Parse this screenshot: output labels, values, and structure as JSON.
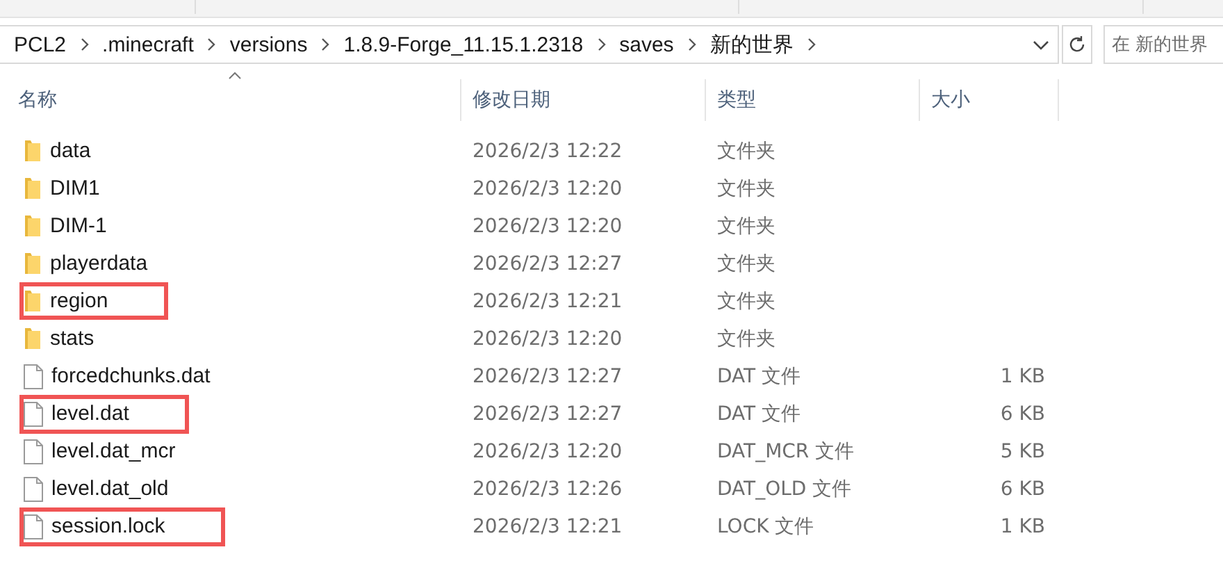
{
  "address_bar": {
    "crumbs": [
      "PCL2",
      ".minecraft",
      "versions",
      "1.8.9-Forge_11.15.1.2318",
      "saves",
      "新的世界"
    ]
  },
  "search": {
    "placeholder": "在 新的世界"
  },
  "table": {
    "columns": [
      {
        "label": "名称",
        "sorted": true
      },
      {
        "label": "修改日期",
        "sorted": false
      },
      {
        "label": "类型",
        "sorted": false
      },
      {
        "label": "大小",
        "sorted": false
      }
    ],
    "rows": [
      {
        "kind": "folder",
        "name": "data",
        "date": "2026/2/3 12:22",
        "type": "文件夹",
        "highlighted": false
      },
      {
        "kind": "folder",
        "name": "DIM1",
        "date": "2026/2/3 12:20",
        "type": "文件夹",
        "highlighted": false
      },
      {
        "kind": "folder",
        "name": "DIM-1",
        "date": "2026/2/3 12:20",
        "type": "文件夹",
        "highlighted": false
      },
      {
        "kind": "folder",
        "name": "playerdata",
        "date": "2026/2/3 12:27",
        "type": "文件夹",
        "highlighted": false
      },
      {
        "kind": "folder",
        "name": "region",
        "date": "2026/2/3 12:21",
        "type": "文件夹",
        "highlighted": true
      },
      {
        "kind": "folder",
        "name": "stats",
        "date": "2026/2/3 12:20",
        "type": "文件夹",
        "highlighted": false
      },
      {
        "kind": "file",
        "name": "forcedchunks.dat",
        "date": "2026/2/3 12:27",
        "type": "DAT 文件",
        "size": "1 KB",
        "highlighted": false
      },
      {
        "kind": "file",
        "name": "level.dat",
        "date": "2026/2/3 12:27",
        "type": "DAT 文件",
        "size": "6 KB",
        "highlighted": true
      },
      {
        "kind": "file",
        "name": "level.dat_mcr",
        "date": "2026/2/3 12:20",
        "type": "DAT_MCR 文件",
        "size": "5 KB",
        "highlighted": false
      },
      {
        "kind": "file",
        "name": "level.dat_old",
        "date": "2026/2/3 12:26",
        "type": "DAT_OLD 文件",
        "size": "6 KB",
        "highlighted": false
      },
      {
        "kind": "file",
        "name": "session.lock",
        "date": "2026/2/3 12:21",
        "type": "LOCK 文件",
        "size": "1 KB",
        "highlighted": true
      }
    ]
  }
}
